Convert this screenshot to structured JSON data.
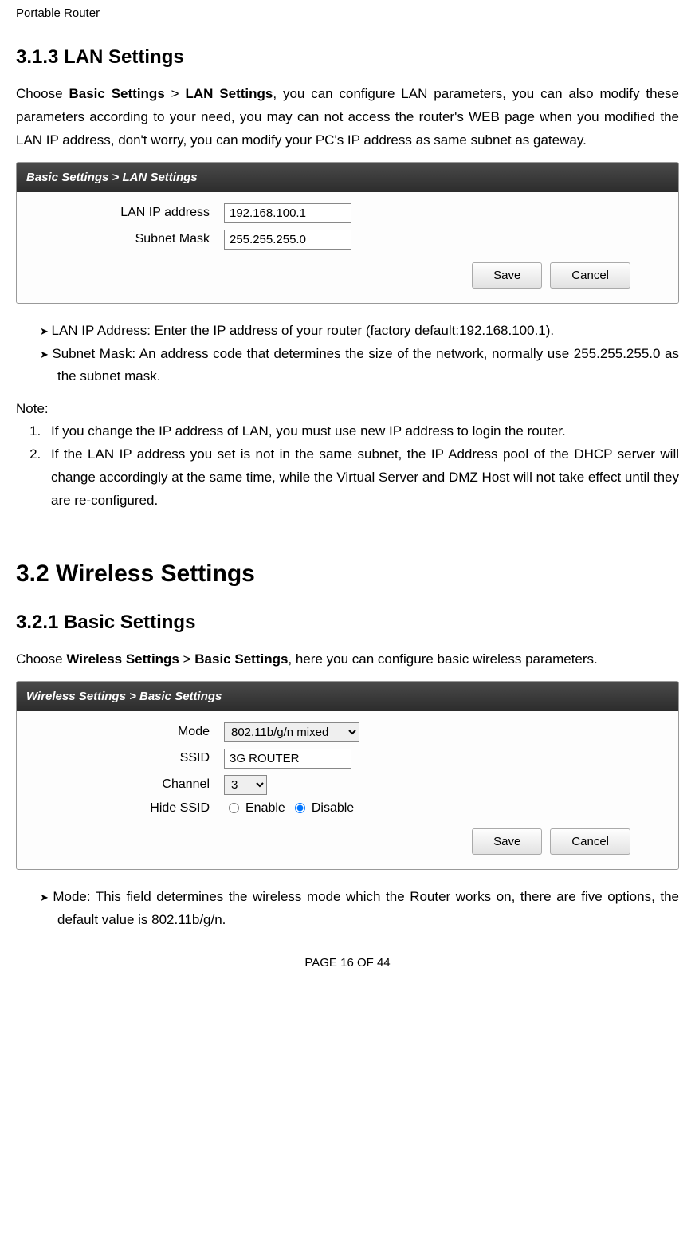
{
  "header": {
    "title": "Portable Router"
  },
  "section313": {
    "heading": "3.1.3 LAN Settings",
    "intro_pre": "Choose ",
    "intro_bold1": "Basic Settings",
    "intro_mid": " > ",
    "intro_bold2": "LAN Settings",
    "intro_post": ", you can configure LAN parameters, you can also modify these parameters according to your need, you may can not access the router's WEB page when you modified the LAN IP address, don't worry, you can modify your PC's IP address as same subnet as gateway."
  },
  "lan_panel": {
    "title": "Basic Settings > LAN Settings",
    "ip_label": "LAN IP address",
    "ip_value": "192.168.100.1",
    "mask_label": "Subnet Mask",
    "mask_value": "255.255.255.0",
    "save": "Save",
    "cancel": "Cancel"
  },
  "lan_bullets": {
    "b1": "LAN IP Address: Enter the IP address of your router (factory default:192.168.100.1).",
    "b2": "Subnet Mask: An address code that determines the size of the network, normally use 255.255.255.0 as the subnet mask."
  },
  "note": {
    "heading": "Note:",
    "n1": "If you change the IP address of LAN, you must use new IP address to login the router.",
    "n2": "If the LAN IP address you set is not in the same subnet, the IP Address pool of the DHCP server will change accordingly at the same time, while the Virtual Server and DMZ Host will not take effect until they are re-configured."
  },
  "section32": {
    "heading": "3.2  Wireless Settings"
  },
  "section321": {
    "heading": "3.2.1 Basic Settings",
    "intro_pre": "Choose ",
    "intro_bold1": "Wireless Settings",
    "intro_mid": " > ",
    "intro_bold2": "Basic Settings",
    "intro_post": ", here you can configure basic wireless parameters."
  },
  "wifi_panel": {
    "title": "Wireless Settings > Basic Settings",
    "mode_label": "Mode",
    "mode_value": "802.11b/g/n mixed",
    "ssid_label": "SSID",
    "ssid_value": "3G ROUTER",
    "channel_label": "Channel",
    "channel_value": "3",
    "hide_label": "Hide SSID",
    "enable": "Enable",
    "disable": "Disable",
    "save": "Save",
    "cancel": "Cancel"
  },
  "wifi_bullets": {
    "b1": "Mode: This field determines the wireless mode which the Router works on, there are five options, the default value is 802.11b/g/n."
  },
  "footer": {
    "text": "PAGE  16  OF  44"
  }
}
